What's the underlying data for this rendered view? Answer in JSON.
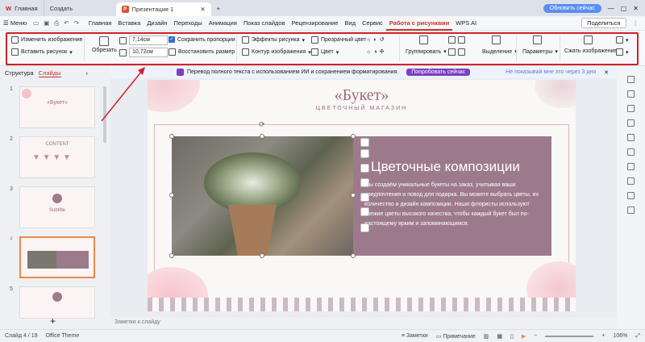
{
  "titlebar": {
    "tab_home": "Главная",
    "tab_create": "Создать",
    "doc_tab": "Презентация 1",
    "update_btn": "Обновить сейчас"
  },
  "menubar": {
    "menu_label": "Меню",
    "items": [
      "Главная",
      "Вставка",
      "Дизайн",
      "Переходы",
      "Анимация",
      "Показ слайдов",
      "Рецензирование",
      "Вид",
      "Сервис",
      "Работа с рисунками",
      "WPS AI"
    ],
    "share": "Поделиться"
  },
  "ribbon": {
    "change_image": "Изменить изображение",
    "insert_image": "Вставить рисунок",
    "crop": "Обрезать",
    "width": "7,14см",
    "height": "10,72см",
    "keep_ratio": "Сохранить пропорции",
    "restore_size": "Восстановить размер",
    "image_effects": "Эффекты рисунка",
    "image_outline": "Контур изображения",
    "transparent_color": "Прозрачный цвет",
    "color": "Цвет",
    "group": "Группировать",
    "selection": "Выделение",
    "params": "Параметры",
    "compress": "Сжать изображение"
  },
  "left": {
    "tab_structure": "Структура",
    "tab_slides": "Слайды",
    "thumb2_title": "CONTENT",
    "thumb3_title": "Subtitle"
  },
  "banner": {
    "text": "Перевод полного текста с использованием ИИ и сохранением форматирования.",
    "try_btn": "Попробовать сейчас",
    "dismiss": "Не показывай мне это через 3 дня"
  },
  "slide": {
    "title": "«Букет»",
    "subtitle": "ЦВЕТОЧНЫЙ МАГАЗИН",
    "heading": "Цветочные композиции",
    "body": "Мы создаём уникальные букеты на заказ, учитывая ваши предпочтения и повод для подарка. Вы можете выбрать цветы, их количество и дизайн композиции. Наши флористы используют свежие цветы высокого качества, чтобы каждый букет был по-настоящему ярким и запоминающимся."
  },
  "notes": "Заметки к слайду",
  "status": {
    "slide": "Слайд 4 / 19",
    "theme": "Office Theme",
    "notes": "Заметки",
    "comment": "Примечание",
    "zoom": "106%"
  },
  "colors": {
    "accent": "#c0392b",
    "highlight": "#d32027",
    "slide_panel": "#9c7a8c"
  }
}
